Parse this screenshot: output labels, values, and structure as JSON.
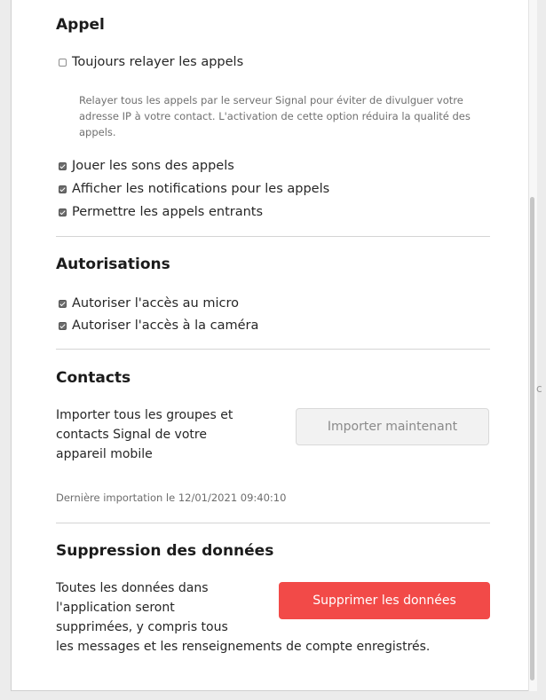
{
  "sections": {
    "appel": {
      "title": "Appel",
      "always_relay_label": "Toujours relayer les appels",
      "always_relay_checked": false,
      "always_relay_hint": "Relayer tous les appels par le serveur Signal pour éviter de divulguer votre adresse IP à votre contact. L'activation de cette option réduira la qualité des appels.",
      "options": [
        {
          "label": "Jouer les sons des appels",
          "checked": true
        },
        {
          "label": "Afficher les notifications pour les appels",
          "checked": true
        },
        {
          "label": "Permettre les appels entrants",
          "checked": true
        }
      ]
    },
    "autorisations": {
      "title": "Autorisations",
      "options": [
        {
          "label": "Autoriser l'accès au micro",
          "checked": true
        },
        {
          "label": "Autoriser l'accès à la caméra",
          "checked": true
        }
      ]
    },
    "contacts": {
      "title": "Contacts",
      "description_lines": [
        "Importer tous les groupes et",
        "contacts Signal de votre",
        "appareil mobile"
      ],
      "import_button": "Importer maintenant",
      "last_import": "Dernière importation le 12/01/2021 09:40:10"
    },
    "suppression": {
      "title": "Suppression des données",
      "description_lines": [
        "Toutes les données dans",
        "l'application seront",
        "supprimées, y compris tous",
        "les messages et les renseignements de compte enregistrés."
      ],
      "delete_button": "Supprimer les données",
      "delete_button_color": "#f24a48"
    }
  }
}
